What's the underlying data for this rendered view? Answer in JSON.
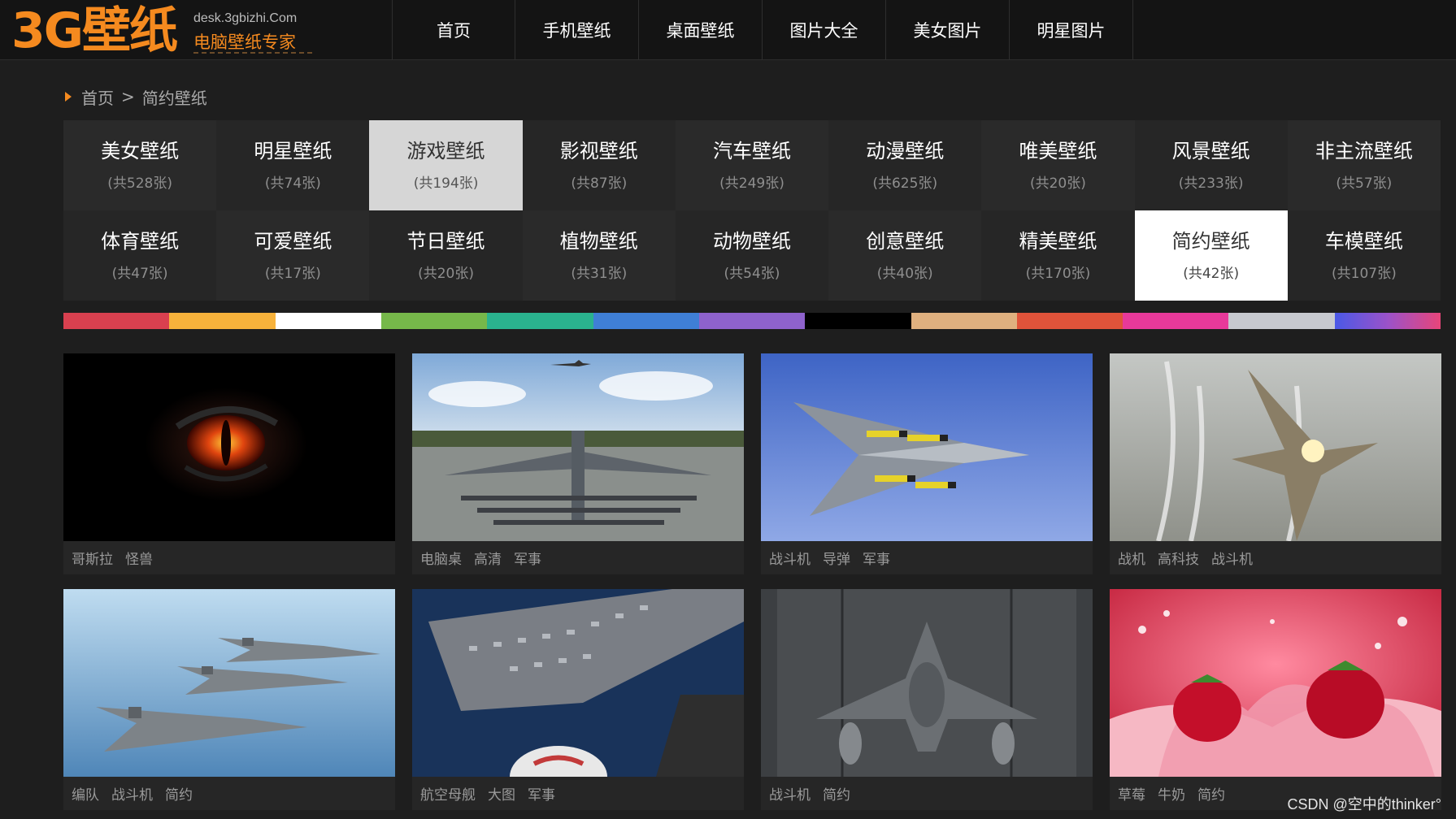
{
  "logo": {
    "mark": "3G壁纸",
    "domain": "desk.3gbizhi.Com",
    "slogan": "电脑壁纸专家"
  },
  "nav": [
    "首页",
    "手机壁纸",
    "桌面壁纸",
    "图片大全",
    "美女图片",
    "明星图片"
  ],
  "breadcrumb": {
    "home": "首页",
    "separator": ">",
    "current": "简约壁纸"
  },
  "categories": [
    {
      "name": "美女壁纸",
      "count": "(共528张)"
    },
    {
      "name": "明星壁纸",
      "count": "(共74张)"
    },
    {
      "name": "游戏壁纸",
      "count": "(共194张)"
    },
    {
      "name": "影视壁纸",
      "count": "(共87张)"
    },
    {
      "name": "汽车壁纸",
      "count": "(共249张)"
    },
    {
      "name": "动漫壁纸",
      "count": "(共625张)"
    },
    {
      "name": "唯美壁纸",
      "count": "(共20张)"
    },
    {
      "name": "风景壁纸",
      "count": "(共233张)"
    },
    {
      "name": "非主流壁纸",
      "count": "(共57张)"
    },
    {
      "name": "体育壁纸",
      "count": "(共47张)"
    },
    {
      "name": "可爱壁纸",
      "count": "(共17张)"
    },
    {
      "name": "节日壁纸",
      "count": "(共20张)"
    },
    {
      "name": "植物壁纸",
      "count": "(共31张)"
    },
    {
      "name": "动物壁纸",
      "count": "(共54张)"
    },
    {
      "name": "创意壁纸",
      "count": "(共40张)"
    },
    {
      "name": "精美壁纸",
      "count": "(共170张)"
    },
    {
      "name": "简约壁纸",
      "count": "(共42张)"
    },
    {
      "name": "车模壁纸",
      "count": "(共107张)"
    }
  ],
  "colors": [
    "#d9404f",
    "#f7b23b",
    "#ffffff",
    "#76b84a",
    "#2ab38e",
    "#3f7fd6",
    "#8e62cc",
    "#000000",
    "#dfb07f",
    "#e0533a",
    "#e8399a",
    "#c7c9cf"
  ],
  "thumbnails": [
    {
      "tags": [
        "哥斯拉",
        "怪兽"
      ]
    },
    {
      "tags": [
        "电脑桌",
        "高清",
        "军事"
      ]
    },
    {
      "tags": [
        "战斗机",
        "导弹",
        "军事"
      ]
    },
    {
      "tags": [
        "战机",
        "高科技",
        "战斗机"
      ]
    },
    {
      "tags": [
        "编队",
        "战斗机",
        "简约"
      ]
    },
    {
      "tags": [
        "航空母舰",
        "大图",
        "军事"
      ]
    },
    {
      "tags": [
        "战斗机",
        "简约"
      ]
    },
    {
      "tags": [
        "草莓",
        "牛奶",
        "简约"
      ]
    }
  ],
  "watermark": "CSDN @空中的thinker°"
}
